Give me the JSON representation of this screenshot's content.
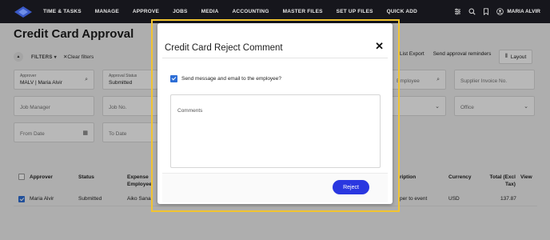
{
  "nav": {
    "items": [
      "TIME & TASKS",
      "MANAGE",
      "APPROVE",
      "JOBS",
      "MEDIA",
      "ACCOUNTING",
      "MASTER FILES",
      "SET UP FILES",
      "QUICK ADD"
    ],
    "user_name": "MARIA ALVIR"
  },
  "page": {
    "title": "Credit Card Approval"
  },
  "filter_bar": {
    "collapse_glyph": "▲",
    "filters_label": "FILTERS",
    "filters_glyph": "▾",
    "clear_label": "Clear filters"
  },
  "actions": {
    "list_export": "List Export",
    "send_reminders": "Send approval reminders",
    "layout": "Layout"
  },
  "filters": {
    "approver_label": "Approver",
    "approver_value": "MALV | Maria Alvir",
    "approval_status_label": "Approval Status",
    "approval_status_value": "Submitted",
    "employee_placeholder": "Employee",
    "supplier_invoice_placeholder": "Supplier Invoice No.",
    "job_manager_placeholder": "Job Manager",
    "job_no_placeholder": "Job No.",
    "office_placeholder": "Office",
    "from_date_placeholder": "From Date",
    "to_date_placeholder": "To Date"
  },
  "table": {
    "headers": {
      "approver": "Approver",
      "status": "Status",
      "expense_line1": "Expense",
      "expense_line2": "Employee",
      "description": "ription",
      "currency": "Currency",
      "total_line1": "Total (Excl",
      "total_line2": "Tax)",
      "view": "View"
    },
    "rows": [
      {
        "approver": "Maria Alvir",
        "status": "Submitted",
        "employee": "Aiko Sana",
        "description": "per to event",
        "currency": "USD",
        "total": "137.87"
      }
    ]
  },
  "modal": {
    "title": "Credit Card Reject Comment",
    "close_glyph": "✕",
    "send_label": "Send message and email to the employee?",
    "comments_placeholder": "Comments",
    "reject_label": "Reject"
  },
  "colors": {
    "accent": "#2a37e0",
    "checkbox": "#2d6ed6",
    "highlight": "#f2c430",
    "nav_bg": "#16161c"
  }
}
